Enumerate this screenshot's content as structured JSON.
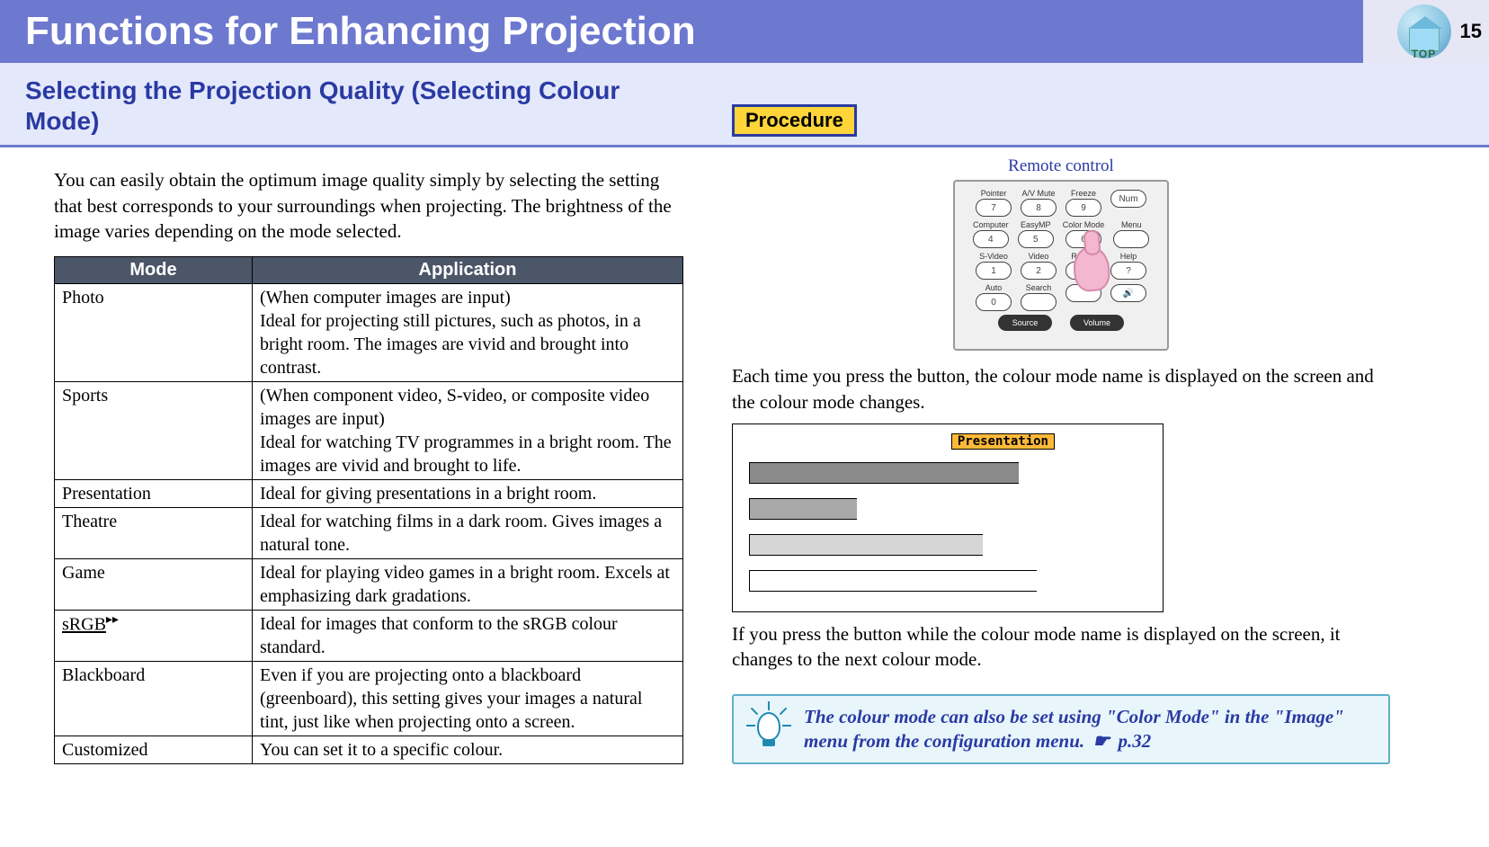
{
  "header": {
    "title": "Functions for Enhancing Projection",
    "page_number": "15",
    "top_icon_label": "TOP",
    "top_icon_name": "home-top-icon"
  },
  "subheader": {
    "title": "Selecting the Projection Quality (Selecting Colour Mode)"
  },
  "left": {
    "intro": "You can easily obtain the optimum image quality simply by selecting the setting that best corresponds to your surroundings when projecting. The brightness of the image varies depending on the mode selected.",
    "table": {
      "columns": [
        "Mode",
        "Application"
      ],
      "rows": [
        {
          "mode": "Photo",
          "application": "(When computer images are input)\nIdeal for projecting still pictures, such as photos, in a bright room. The images are vivid and brought into contrast."
        },
        {
          "mode": "Sports",
          "application": "(When component video, S-video, or composite video images are input)\nIdeal for watching TV programmes in a bright room. The images are vivid and brought to life."
        },
        {
          "mode": "Presentation",
          "application": "Ideal for giving presentations in a bright room."
        },
        {
          "mode": "Theatre",
          "application": "Ideal for watching films in a dark room.  Gives images a natural tone."
        },
        {
          "mode": "Game",
          "application": "Ideal for playing video games in a bright room. Excels at emphasizing dark gradations."
        },
        {
          "mode": "sRGB",
          "glossary": true,
          "application": "Ideal for images that conform to the sRGB colour standard."
        },
        {
          "mode": "Blackboard",
          "application": "Even if you are projecting onto a blackboard (greenboard), this setting gives your images a natural tint, just like when projecting onto a screen."
        },
        {
          "mode": "Customized",
          "application": "You can set it to a specific colour."
        }
      ]
    }
  },
  "right": {
    "procedure_label": "Procedure",
    "remote_label": "Remote control",
    "remote": {
      "row1": [
        {
          "label": "Pointer",
          "btn": "7"
        },
        {
          "label": "A/V Mute",
          "btn": "8"
        },
        {
          "label": "Freeze",
          "btn": "9"
        },
        {
          "label": "",
          "btn": "Num"
        }
      ],
      "row2": [
        {
          "label": "Computer",
          "btn": "4"
        },
        {
          "label": "EasyMP",
          "btn": "5"
        },
        {
          "label": "Color Mode",
          "btn": "6"
        },
        {
          "label": "Menu",
          "btn": ""
        }
      ],
      "row3": [
        {
          "label": "S-Video",
          "btn": "1"
        },
        {
          "label": "Video",
          "btn": "2"
        },
        {
          "label": "Resize",
          "btn": "3"
        },
        {
          "label": "Help",
          "btn": "?"
        }
      ],
      "row4": [
        {
          "label": "Auto",
          "btn": "0"
        },
        {
          "label": "Search",
          "btn": ""
        },
        {
          "label": "",
          "btn": ""
        },
        {
          "label": "",
          "btn": "🔊"
        }
      ],
      "source_label": "Source",
      "volume_label": "Volume"
    },
    "para1": "Each time you press the button, the colour mode name is displayed on the screen and the colour mode changes.",
    "mode_badge": "Presentation",
    "para2": "If you press the button while the colour mode name is displayed on the screen, it changes to the next colour mode.",
    "tip": {
      "text_a": "The colour mode can also be set using \"Color Mode\" in the \"Image\" menu from the configuration menu. ",
      "page_ref": "p.32"
    }
  }
}
